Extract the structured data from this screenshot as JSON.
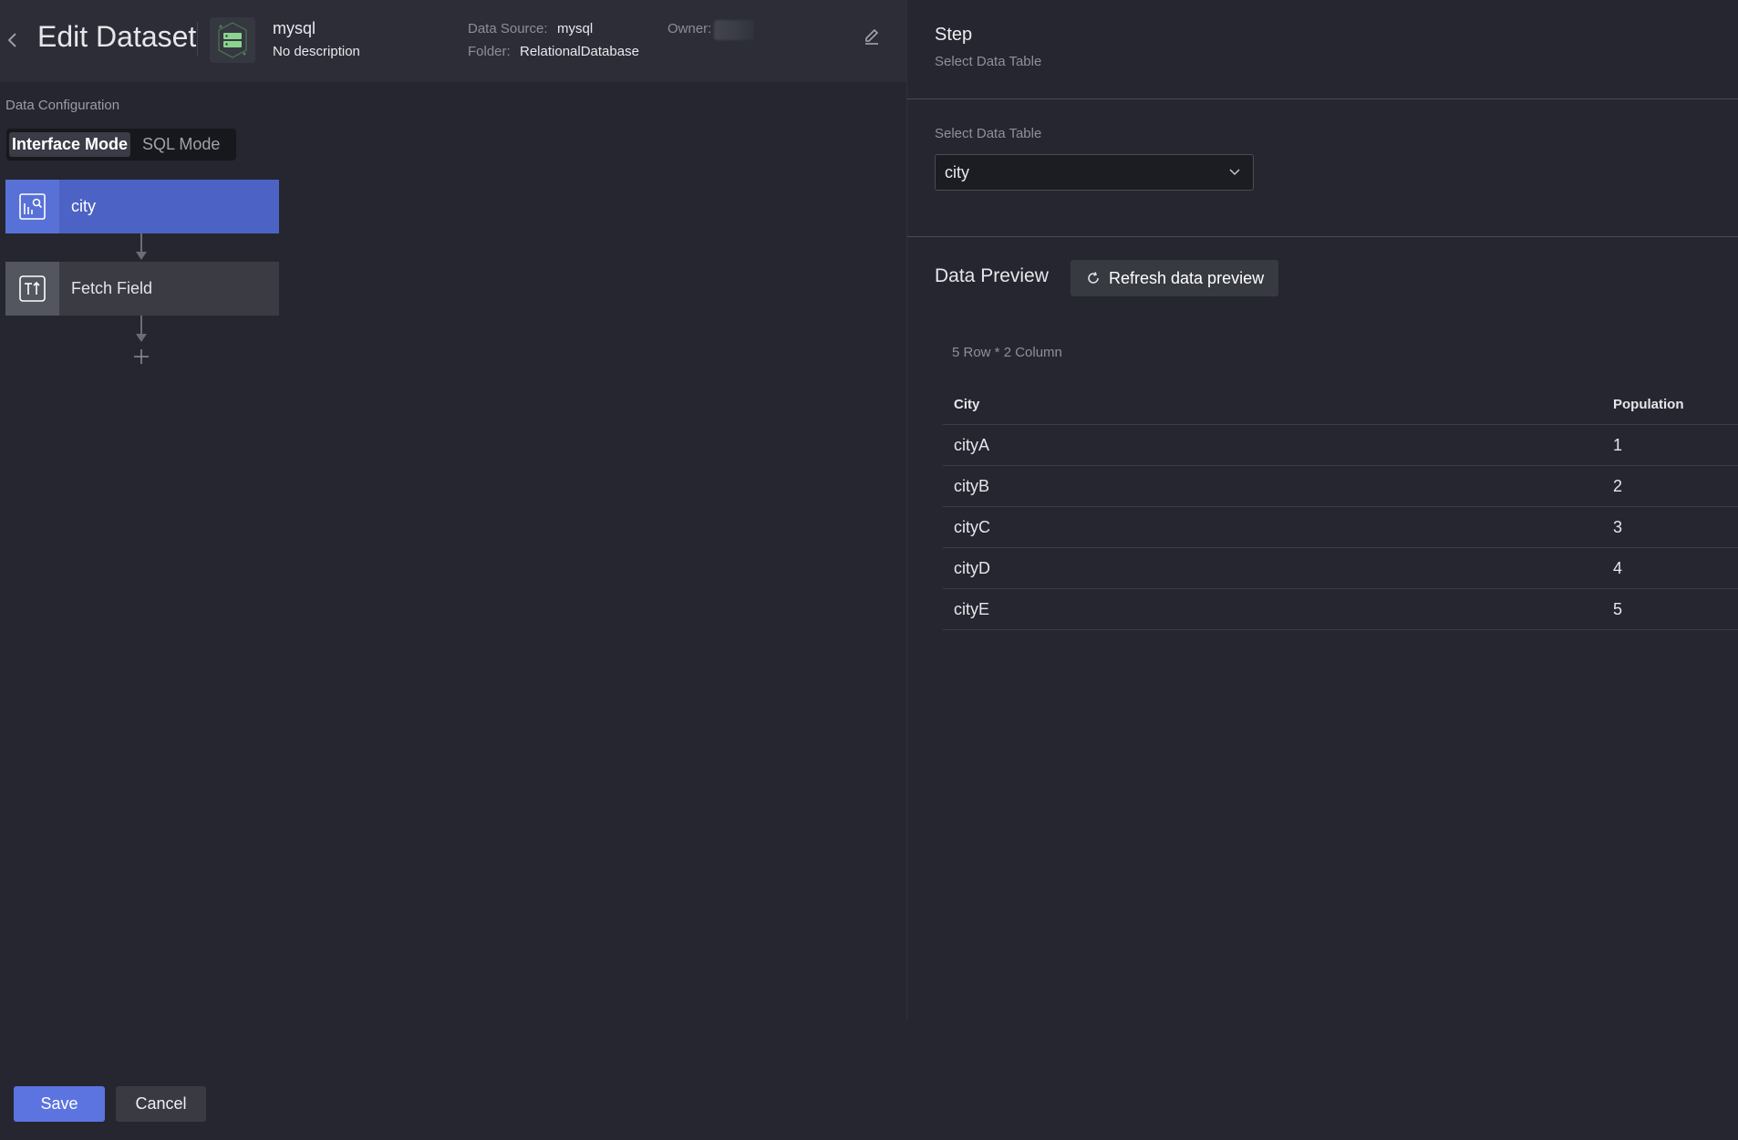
{
  "header": {
    "title": "Edit Dataset",
    "dataset_name": "mysql",
    "dataset_description": "No description",
    "data_source_label": "Data Source:",
    "data_source_value": "mysql",
    "folder_label": "Folder:",
    "folder_value": "RelationalDatabase",
    "owner_label": "Owner:"
  },
  "config": {
    "section_label": "Data Configuration",
    "modes": {
      "active": "Interface Mode",
      "inactive": "SQL Mode"
    },
    "nodes": [
      {
        "label": "city",
        "icon": "table-search-icon"
      },
      {
        "label": "Fetch Field",
        "icon": "fetch-field-icon"
      }
    ]
  },
  "footer": {
    "save_label": "Save",
    "cancel_label": "Cancel"
  },
  "step": {
    "title": "Step",
    "subtitle": "Select Data Table",
    "select_label": "Select Data Table",
    "select_value": "city"
  },
  "preview": {
    "title": "Data Preview",
    "refresh_label": "Refresh data preview",
    "row_count": "5 Row * 2 Column",
    "columns": [
      "City",
      "Population"
    ],
    "rows": [
      [
        "cityA",
        "1"
      ],
      [
        "cityB",
        "2"
      ],
      [
        "cityC",
        "3"
      ],
      [
        "cityD",
        "4"
      ],
      [
        "cityE",
        "5"
      ]
    ]
  },
  "colors": {
    "background": "#25262f",
    "header_bg": "#2c2d36",
    "accent": "#5b74e0",
    "active_node": "#4c62c4",
    "dataset_icon_green": "#8bd38f"
  }
}
